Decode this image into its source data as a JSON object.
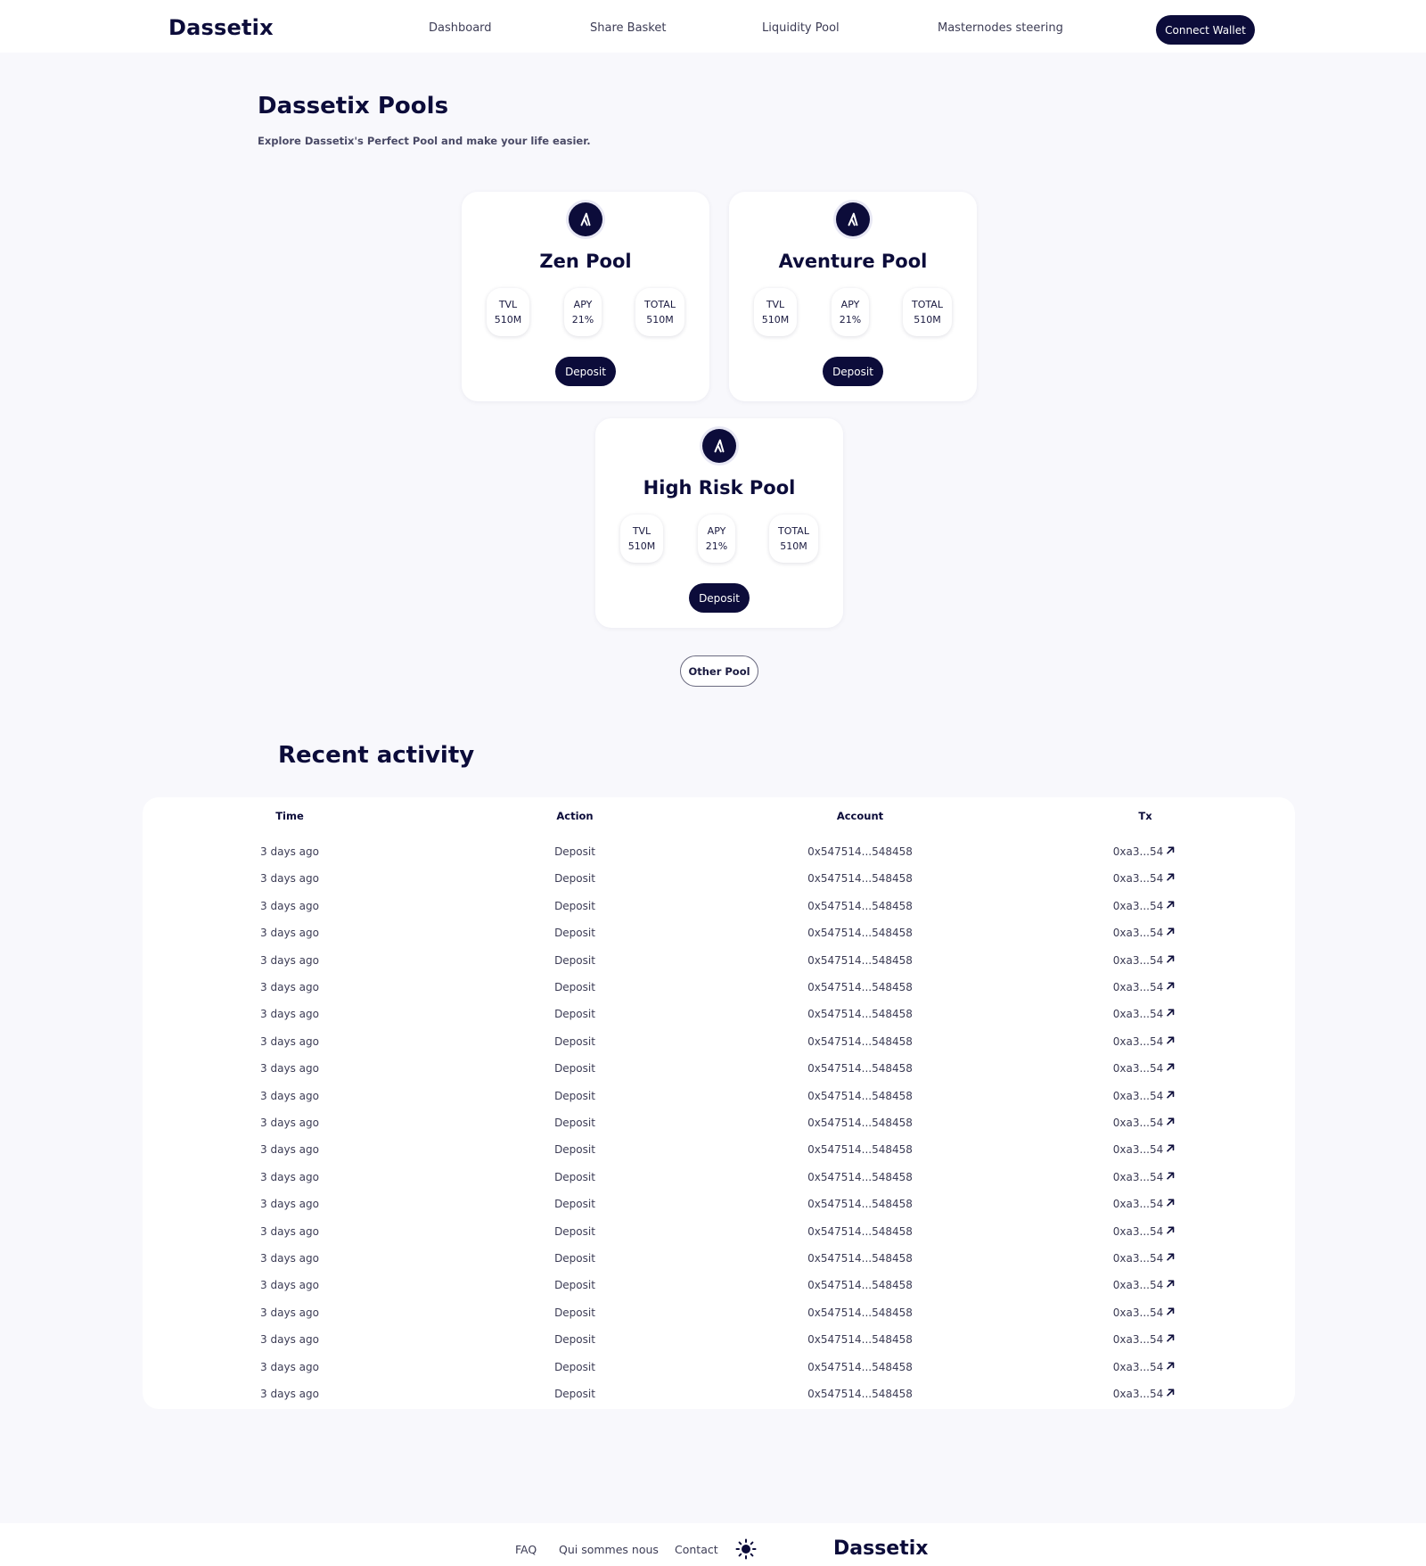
{
  "header": {
    "logo": "Dassetix",
    "nav": [
      "Dashboard",
      "Share Basket",
      "Liquidity Pool",
      "Masternodes steering"
    ],
    "connect_wallet": "Connect Wallet"
  },
  "intro": {
    "title": "Dassetix Pools",
    "subtitle": "Explore Dassetix's Perfect Pool and make your life easier."
  },
  "pools": [
    {
      "name": "Zen Pool",
      "tvl_label": "TVL",
      "tvl_value": "510M",
      "apy_label": "APY",
      "apy_value": "21%",
      "total_label": "TOTAL",
      "total_value": "510M",
      "deposit": "Deposit",
      "icon": "pool-logo-icon"
    },
    {
      "name": "Aventure Pool",
      "tvl_label": "TVL",
      "tvl_value": "510M",
      "apy_label": "APY",
      "apy_value": "21%",
      "total_label": "TOTAL",
      "total_value": "510M",
      "deposit": "Deposit",
      "icon": "pool-logo-icon"
    },
    {
      "name": "High Risk Pool",
      "tvl_label": "TVL",
      "tvl_value": "510M",
      "apy_label": "APY",
      "apy_value": "21%",
      "total_label": "TOTAL",
      "total_value": "510M",
      "deposit": "Deposit",
      "icon": "pool-logo-icon"
    }
  ],
  "other_pool": "Other Pool",
  "activity": {
    "title": "Recent activity",
    "columns": [
      "Time",
      "Action",
      "Account",
      "Tx"
    ],
    "rows": [
      {
        "time": "3 days ago",
        "action": "Deposit",
        "account": "0x547514...548458",
        "tx": "0xa3...54"
      },
      {
        "time": "3 days ago",
        "action": "Deposit",
        "account": "0x547514...548458",
        "tx": "0xa3...54"
      },
      {
        "time": "3 days ago",
        "action": "Deposit",
        "account": "0x547514...548458",
        "tx": "0xa3...54"
      },
      {
        "time": "3 days ago",
        "action": "Deposit",
        "account": "0x547514...548458",
        "tx": "0xa3...54"
      },
      {
        "time": "3 days ago",
        "action": "Deposit",
        "account": "0x547514...548458",
        "tx": "0xa3...54"
      },
      {
        "time": "3 days ago",
        "action": "Deposit",
        "account": "0x547514...548458",
        "tx": "0xa3...54"
      },
      {
        "time": "3 days ago",
        "action": "Deposit",
        "account": "0x547514...548458",
        "tx": "0xa3...54"
      },
      {
        "time": "3 days ago",
        "action": "Deposit",
        "account": "0x547514...548458",
        "tx": "0xa3...54"
      },
      {
        "time": "3 days ago",
        "action": "Deposit",
        "account": "0x547514...548458",
        "tx": "0xa3...54"
      },
      {
        "time": "3 days ago",
        "action": "Deposit",
        "account": "0x547514...548458",
        "tx": "0xa3...54"
      },
      {
        "time": "3 days ago",
        "action": "Deposit",
        "account": "0x547514...548458",
        "tx": "0xa3...54"
      },
      {
        "time": "3 days ago",
        "action": "Deposit",
        "account": "0x547514...548458",
        "tx": "0xa3...54"
      },
      {
        "time": "3 days ago",
        "action": "Deposit",
        "account": "0x547514...548458",
        "tx": "0xa3...54"
      },
      {
        "time": "3 days ago",
        "action": "Deposit",
        "account": "0x547514...548458",
        "tx": "0xa3...54"
      },
      {
        "time": "3 days ago",
        "action": "Deposit",
        "account": "0x547514...548458",
        "tx": "0xa3...54"
      },
      {
        "time": "3 days ago",
        "action": "Deposit",
        "account": "0x547514...548458",
        "tx": "0xa3...54"
      },
      {
        "time": "3 days ago",
        "action": "Deposit",
        "account": "0x547514...548458",
        "tx": "0xa3...54"
      },
      {
        "time": "3 days ago",
        "action": "Deposit",
        "account": "0x547514...548458",
        "tx": "0xa3...54"
      },
      {
        "time": "3 days ago",
        "action": "Deposit",
        "account": "0x547514...548458",
        "tx": "0xa3...54"
      },
      {
        "time": "3 days ago",
        "action": "Deposit",
        "account": "0x547514...548458",
        "tx": "0xa3...54"
      },
      {
        "time": "3 days ago",
        "action": "Deposit",
        "account": "0x547514...548458",
        "tx": "0xa3...54"
      }
    ],
    "tx_icon": "external-link-arrow-icon"
  },
  "footer": {
    "links": [
      "FAQ",
      "Qui sommes nous",
      "Contact"
    ],
    "theme_icon": "sun-icon",
    "logo": "Dassetix"
  },
  "colors": {
    "navy": "#0c0c3a",
    "background": "#f8f8fc",
    "card": "#ffffff"
  }
}
